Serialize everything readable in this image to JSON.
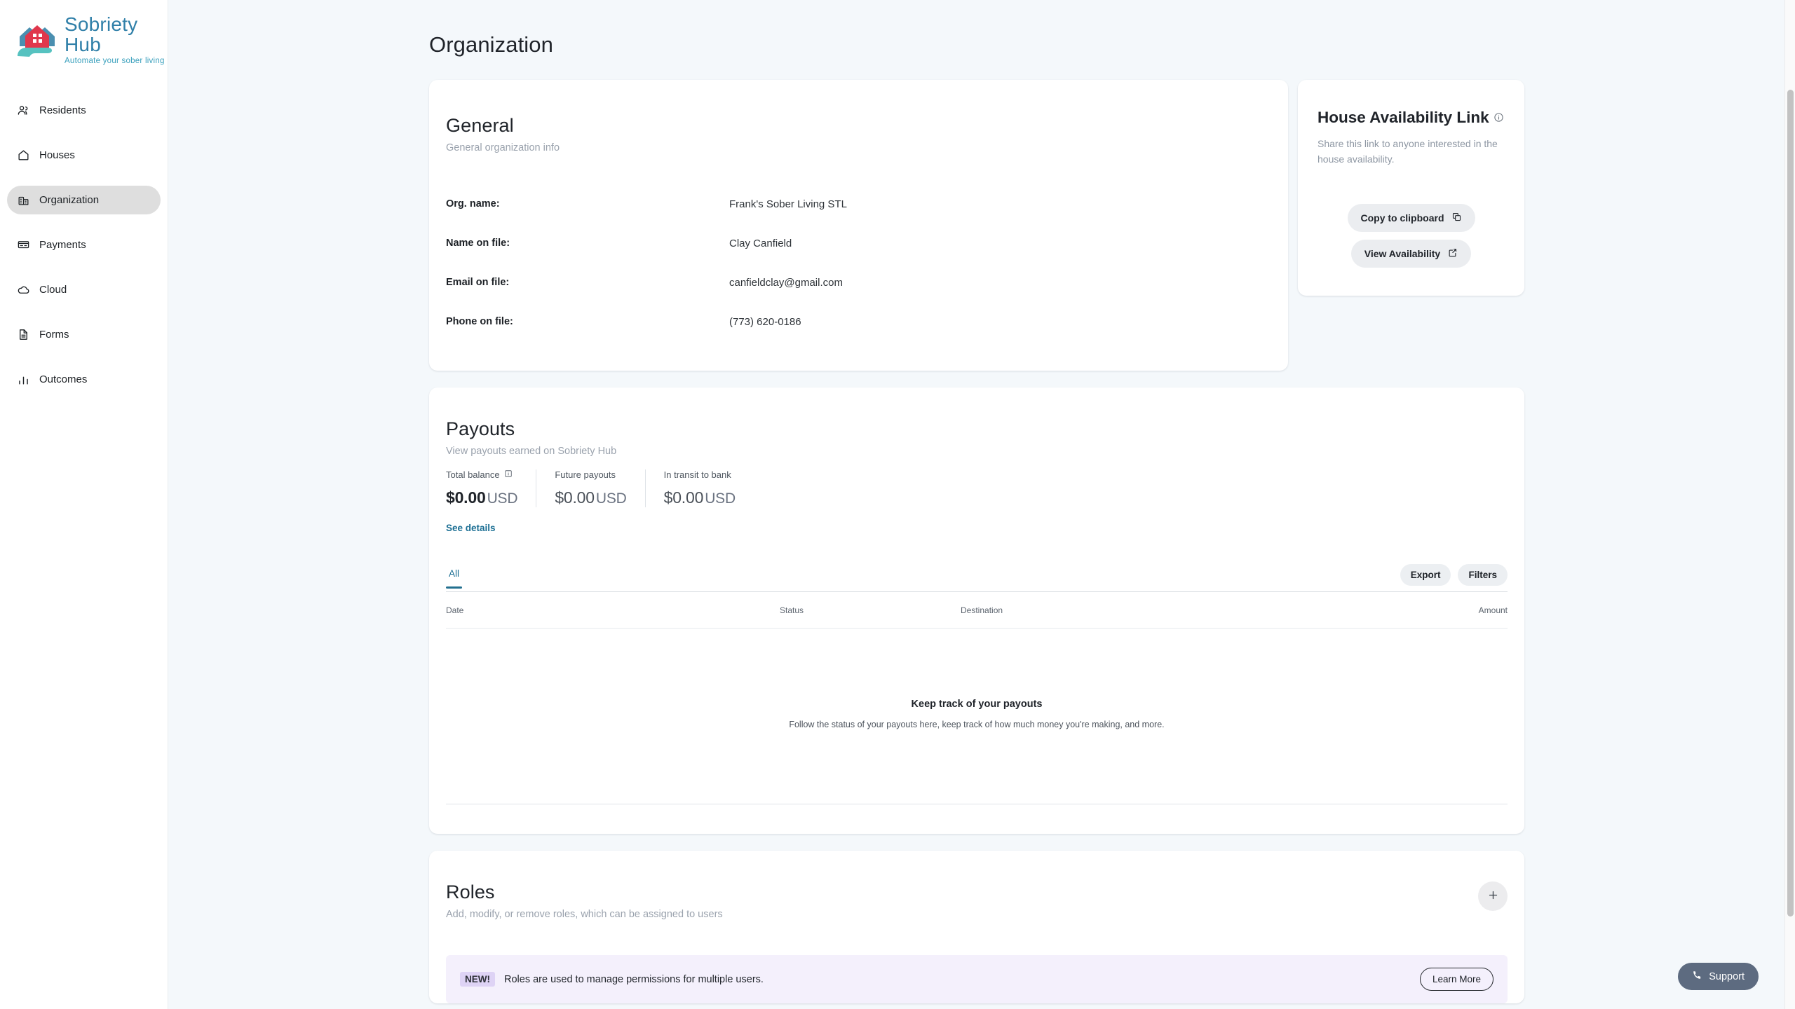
{
  "brand": {
    "name": "Sobriety Hub",
    "tagline": "Automate your sober living",
    "logo_icon": "house-in-hand-logo",
    "title_color": "#2f7fa8",
    "tagline_color": "#3aa0bd",
    "house_red": "#e0374c",
    "house_blue": "#4a8fb0",
    "hand_teal": "#56c2c0"
  },
  "sidebar": {
    "items": [
      {
        "label": "Residents",
        "icon": "people-icon",
        "active": false
      },
      {
        "label": "Houses",
        "icon": "home-icon",
        "active": false
      },
      {
        "label": "Organization",
        "icon": "building-icon",
        "active": true
      },
      {
        "label": "Payments",
        "icon": "card-icon",
        "active": false
      },
      {
        "label": "Cloud",
        "icon": "cloud-icon",
        "active": false
      },
      {
        "label": "Forms",
        "icon": "document-icon",
        "active": false
      },
      {
        "label": "Outcomes",
        "icon": "bar-chart-icon",
        "active": false
      }
    ]
  },
  "page": {
    "title": "Organization"
  },
  "general": {
    "title": "General",
    "subtitle": "General organization info",
    "fields": [
      {
        "label": "Org. name:",
        "value": "Frank's Sober Living STL"
      },
      {
        "label": "Name on file:",
        "value": "Clay Canfield"
      },
      {
        "label": "Email on file:",
        "value": "canfieldclay@gmail.com"
      },
      {
        "label": "Phone on file:",
        "value": "(773) 620-0186"
      }
    ]
  },
  "house_availability": {
    "title": "House Availability Link",
    "info_icon": "info-circle-icon",
    "description": "Share this link to anyone interested in the house availability.",
    "copy_button": "Copy to clipboard",
    "copy_icon": "copy-icon",
    "view_button": "View Availability",
    "view_icon": "external-link-icon"
  },
  "payouts": {
    "title": "Payouts",
    "subtitle": "View payouts earned on Sobriety Hub",
    "stats": [
      {
        "label": "Total balance",
        "value": "$0.00",
        "currency": "USD",
        "info_icon": "info-square-icon"
      },
      {
        "label": "Future payouts",
        "value": "$0.00",
        "currency": "USD",
        "info_icon": ""
      },
      {
        "label": "In transit to bank",
        "value": "$0.00",
        "currency": "USD",
        "info_icon": ""
      }
    ],
    "see_details": "See details",
    "tabs": [
      {
        "label": "All",
        "active": true
      }
    ],
    "export_button": "Export",
    "filters_button": "Filters",
    "table": {
      "columns": [
        "Date",
        "Status",
        "Destination",
        "Amount"
      ],
      "rows": [],
      "empty_title": "Keep track of your payouts",
      "empty_subtitle": "Follow the status of your payouts here, keep track of how much money you're making, and more."
    }
  },
  "roles": {
    "title": "Roles",
    "subtitle": "Add, modify, or remove roles, which can be assigned to users",
    "add_icon": "plus-icon",
    "banner": {
      "badge": "NEW!",
      "badge_color": "#ded3f5",
      "background": "#f4f0fc",
      "text": "Roles are used to manage permissions for multiple users.",
      "button": "Learn More"
    }
  },
  "support": {
    "label": "Support",
    "icon": "phone-icon",
    "color": "#5d6b80"
  }
}
